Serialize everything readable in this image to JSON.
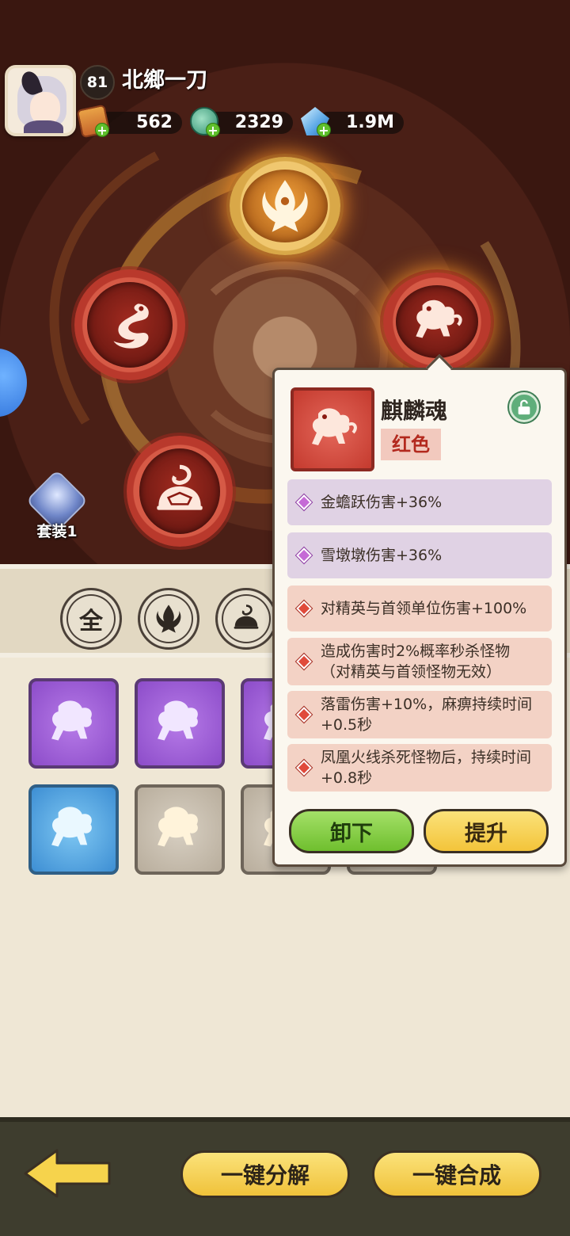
{
  "header": {
    "level": "81",
    "username": "北鄉一刀"
  },
  "resources": [
    {
      "icon": "scroll-icon",
      "value": "562"
    },
    {
      "icon": "jade-dragon-icon",
      "value": "2329"
    },
    {
      "icon": "crystal-icon",
      "value": "1.9M"
    }
  ],
  "orbs": [
    {
      "name": "phoenix-orb",
      "icon": "phoenix-icon"
    },
    {
      "name": "dragon-orb",
      "icon": "dragon-icon"
    },
    {
      "name": "qilin-orb",
      "icon": "qilin-icon"
    },
    {
      "name": "tortoise-orb",
      "icon": "tortoise-icon"
    }
  ],
  "set_badge": "套装1",
  "filters": [
    "全",
    "phoenix-icon",
    "tortoise-icon"
  ],
  "tiles": [
    "purple",
    "purple",
    "purple",
    "blue",
    "gray",
    "gray"
  ],
  "popup": {
    "name": "麒麟魂",
    "grade": "红色",
    "attributes": [
      {
        "tier": "purple",
        "text": "金蟾跃伤害+36%"
      },
      {
        "tier": "purple",
        "text": "雪墩墩伤害+36%"
      },
      {
        "tier": "red",
        "text": "对精英与首领单位伤害+100%"
      },
      {
        "tier": "red",
        "text": "造成伤害时2%概率秒杀怪物（对精英与首领怪物无效）"
      },
      {
        "tier": "red",
        "text": "落雷伤害+10%，麻痹持续时间+0.5秒"
      },
      {
        "tier": "red",
        "text": "凤凰火线杀死怪物后，持续时间+0.8秒"
      }
    ],
    "unequip_label": "卸下",
    "upgrade_label": "提升"
  },
  "footer": {
    "decompose_label": "一键分解",
    "synthesize_label": "一键合成"
  },
  "colors": {
    "accent_yellow": "#f3c43a",
    "accent_green": "#6fbf2e",
    "grade_red": "#c43a2e",
    "grade_purple": "#8c4cc9"
  }
}
